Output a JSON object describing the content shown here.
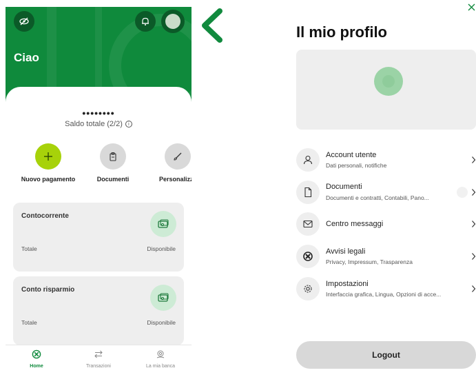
{
  "home": {
    "greeting": "Ciao",
    "balance_masked": "••••••••",
    "balance_label": "Saldo totale (2/2)",
    "actions": [
      {
        "label": "Nuovo pagamento",
        "icon": "plus-icon"
      },
      {
        "label": "Documenti",
        "icon": "clipboard-icon"
      },
      {
        "label": "Personalizz",
        "icon": "brush-icon"
      }
    ],
    "accounts": [
      {
        "title": "Contocorrente",
        "total_label": "Totale",
        "available_label": "Disponibile"
      },
      {
        "title": "Conto risparmio",
        "total_label": "Totale",
        "available_label": "Disponibile"
      }
    ],
    "tabs": [
      {
        "label": "Home",
        "icon": "home-icon",
        "active": true
      },
      {
        "label": "Transazioni",
        "icon": "transfer-arrows-icon",
        "active": false
      },
      {
        "label": "La mia banca",
        "icon": "bank-location-icon",
        "active": false
      }
    ]
  },
  "profile": {
    "title": "Il mio profilo",
    "items": [
      {
        "title": "Account utente",
        "subtitle": "Dati personali, notifiche",
        "icon": "user-icon"
      },
      {
        "title": "Documenti",
        "subtitle": "Documenti e contratti, Contabili, Pano...",
        "icon": "document-icon"
      },
      {
        "title": "Centro messaggi",
        "subtitle": "",
        "icon": "envelope-icon"
      },
      {
        "title": "Avvisi legali",
        "subtitle": "Privacy, Impressum, Trasparenza",
        "icon": "legal-icon"
      },
      {
        "title": "Impostazioni",
        "subtitle": "Interfaccia grafica, Lingua, Opzioni di acce...",
        "icon": "gear-icon"
      }
    ],
    "logout_label": "Logout"
  },
  "colors": {
    "brand_green": "#0f8a3c",
    "accent_lime": "#a7d20a",
    "card_gray": "#eeeeee"
  }
}
